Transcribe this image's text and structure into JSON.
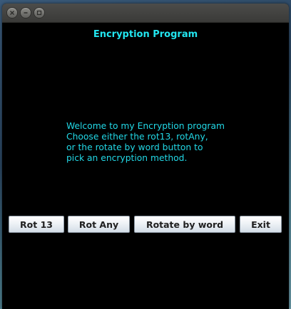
{
  "window": {
    "title": "Encryption Program",
    "controls": [
      "close",
      "minimize",
      "maximize"
    ]
  },
  "message": {
    "lines": [
      "Welcome to my Encryption program",
      "Choose either the rot13, rotAny,",
      "or the rotate by word button to",
      "pick an encryption method."
    ]
  },
  "buttons": {
    "rot13": "Rot 13",
    "rot_any": "Rot Any",
    "rotate_by_word": "Rotate by word",
    "exit": "Exit"
  },
  "colors": {
    "background": "#000000",
    "text_accent": "#22e6f0"
  }
}
